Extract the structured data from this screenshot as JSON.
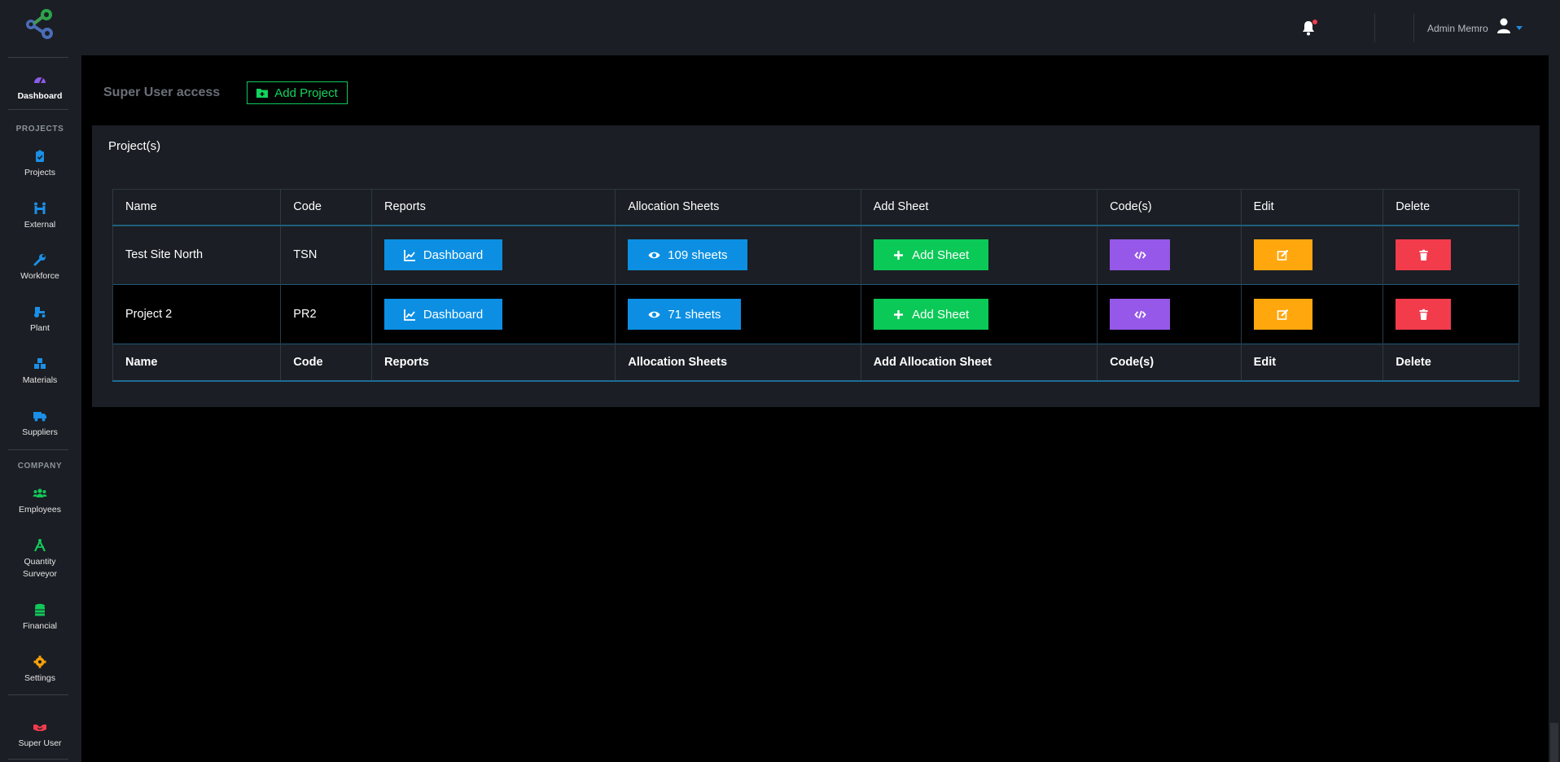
{
  "sidebar": {
    "items": [
      {
        "label": "Dashboard",
        "icon": "gauge-icon"
      },
      {
        "label": "Projects",
        "icon": "clipboard-check-icon"
      },
      {
        "label": "External",
        "icon": "people-carry-icon"
      },
      {
        "label": "Workforce",
        "icon": "wrench-icon"
      },
      {
        "label": "Plant",
        "icon": "tractor-icon"
      },
      {
        "label": "Materials",
        "icon": "cubes-icon"
      },
      {
        "label": "Suppliers",
        "icon": "truck-icon"
      },
      {
        "label": "Employees",
        "icon": "users-icon"
      },
      {
        "label": "Quantity Surveyor",
        "icon": "compass-drafting-icon"
      },
      {
        "label": "Financial",
        "icon": "coins-stack-icon"
      },
      {
        "label": "Settings",
        "icon": "gear-icon"
      },
      {
        "label": "Super User",
        "icon": "handshake-icon"
      }
    ],
    "sections": {
      "projects": "PROJECTS",
      "company": "COMPANY"
    }
  },
  "topbar": {
    "user_name": "Admin Memro"
  },
  "page": {
    "title": "Super User access",
    "add_project_label": "Add Project"
  },
  "card": {
    "title": "Project(s)"
  },
  "table": {
    "headers": [
      "Name",
      "Code",
      "Reports",
      "Allocation Sheets",
      "Add Sheet",
      "Code(s)",
      "Edit",
      "Delete"
    ],
    "footer": [
      "Name",
      "Code",
      "Reports",
      "Allocation Sheets",
      "Add Allocation Sheet",
      "Code(s)",
      "Edit",
      "Delete"
    ],
    "rows": [
      {
        "name": "Test Site North",
        "code": "TSN",
        "report_label": "Dashboard",
        "sheets_label": "109 sheets",
        "add_sheet_label": "Add Sheet"
      },
      {
        "name": "Project 2",
        "code": "PR2",
        "report_label": "Dashboard",
        "sheets_label": "71 sheets",
        "add_sheet_label": "Add Sheet"
      }
    ]
  },
  "colors": {
    "accent_blue": "#0c8fe3",
    "success_green": "#0bc957",
    "purple": "#9658e8",
    "warning_orange": "#ffa70d",
    "danger_red": "#f23c4c"
  }
}
